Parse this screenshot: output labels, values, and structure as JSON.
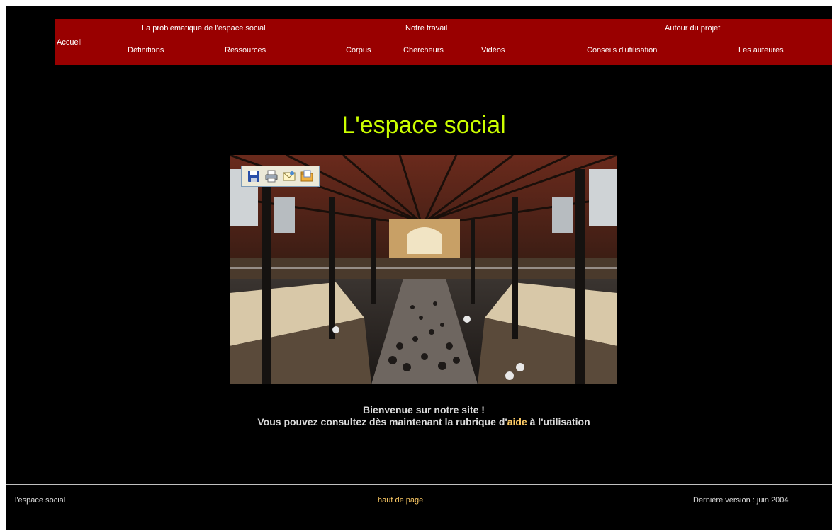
{
  "navbar": {
    "home": "Accueil",
    "groups": {
      "problem": "La problématique de l'espace social",
      "work": "Notre travail",
      "about": "Autour du projet"
    },
    "links": {
      "definitions": "Définitions",
      "resources": "Ressources",
      "corpus": "Corpus",
      "researchers": "Chercheurs",
      "videos": "Vidéos",
      "usage_tips": "Conseils d'utilisation",
      "authors": "Les auteures"
    }
  },
  "main": {
    "title": "L'espace social",
    "welcome_line1": "Bienvenue sur notre site !",
    "welcome_line2_pre": "Vous pouvez consultez dès maintenant la rubrique d'",
    "welcome_link": "aide",
    "welcome_line2_post": " à l'utilisation"
  },
  "image_toolbar": {
    "icons": [
      "save-icon",
      "print-icon",
      "email-icon",
      "folder-icon"
    ]
  },
  "footer": {
    "left": "l'espace social",
    "center": "haut de page",
    "right": "Dernière version : juin 2004"
  },
  "colors": {
    "background": "#000000",
    "navbar": "#990000",
    "title": "#ccff00",
    "link_accent": "#ffcc66",
    "text": "#dcdcdc"
  }
}
